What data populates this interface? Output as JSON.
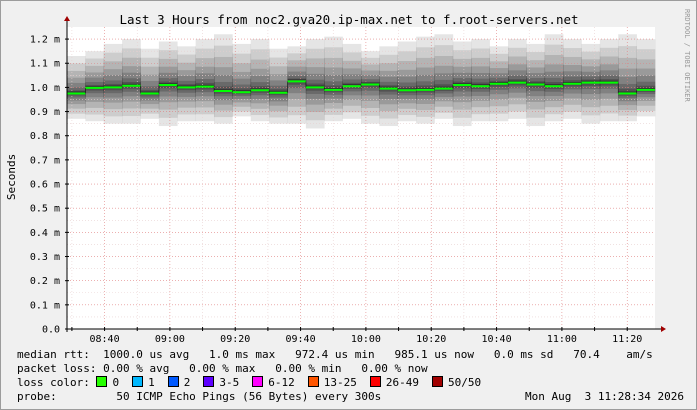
{
  "title": "Last 3 Hours from noc2.gva20.ip-max.net to f.root-servers.net",
  "watermark": "RRDTOOL / TOBI OETIKER",
  "chart_data": {
    "type": "line",
    "title": "Last 3 Hours from noc2.gva20.ip-max.net to f.root-servers.net",
    "ylabel": "Seconds",
    "ylim": [
      0,
      1.25
    ],
    "yticks": [
      {
        "v": 0,
        "label": "0.0"
      },
      {
        "v": 0.1,
        "label": "0.1 m"
      },
      {
        "v": 0.2,
        "label": "0.2 m"
      },
      {
        "v": 0.3,
        "label": "0.3 m"
      },
      {
        "v": 0.4,
        "label": "0.4 m"
      },
      {
        "v": 0.5,
        "label": "0.5 m"
      },
      {
        "v": 0.6,
        "label": "0.6 m"
      },
      {
        "v": 0.7,
        "label": "0.7 m"
      },
      {
        "v": 0.8,
        "label": "0.8 m"
      },
      {
        "v": 0.9,
        "label": "0.9 m"
      },
      {
        "v": 1.0,
        "label": "1.0 m"
      },
      {
        "v": 1.1,
        "label": "1.1 m"
      },
      {
        "v": 1.2,
        "label": "1.2 m"
      }
    ],
    "xticks": [
      "08:40",
      "09:00",
      "09:20",
      "09:40",
      "10:00",
      "10:20",
      "10:40",
      "11:00",
      "11:20"
    ],
    "series": [
      {
        "name": "median rtt",
        "color": "#00ff00",
        "values": [
          0.975,
          0.998,
          1.0,
          1.007,
          0.975,
          1.01,
          1.0,
          1.003,
          0.985,
          0.98,
          0.988,
          0.978,
          1.025,
          1.0,
          0.99,
          1.005,
          1.012,
          0.995,
          0.988,
          0.99,
          0.995,
          1.01,
          1.005,
          1.015,
          1.02,
          1.012,
          1.005,
          1.015,
          1.02,
          1.02,
          0.975,
          0.99
        ]
      }
    ],
    "spread_max": [
      1.13,
      1.15,
      1.18,
      1.2,
      1.16,
      1.19,
      1.17,
      1.2,
      1.22,
      1.18,
      1.2,
      1.16,
      1.17,
      1.2,
      1.21,
      1.18,
      1.15,
      1.17,
      1.19,
      1.21,
      1.22,
      1.19,
      1.2,
      1.17,
      1.2,
      1.18,
      1.22,
      1.2,
      1.18,
      1.2,
      1.22,
      1.2
    ],
    "spread_min": [
      0.87,
      0.86,
      0.85,
      0.85,
      0.87,
      0.84,
      0.86,
      0.86,
      0.85,
      0.88,
      0.86,
      0.85,
      0.85,
      0.83,
      0.86,
      0.87,
      0.85,
      0.84,
      0.86,
      0.85,
      0.87,
      0.84,
      0.86,
      0.86,
      0.87,
      0.84,
      0.86,
      0.87,
      0.85,
      0.86,
      0.86,
      0.88
    ]
  },
  "legend": {
    "median_line": "median rtt:  1000.0 us avg   1.0 ms max   972.4 us min   985.1 us now   0.0 ms sd   70.4    am/s",
    "loss_line": "packet loss: 0.00 % avg   0.00 % max   0.00 % min   0.00 % now",
    "loss_color_label": "loss color:",
    "loss_colors": [
      {
        "label": "0",
        "color": "#26ff00"
      },
      {
        "label": "1",
        "color": "#00b8ff"
      },
      {
        "label": "2",
        "color": "#0059ff"
      },
      {
        "label": "3-5",
        "color": "#5e00ff"
      },
      {
        "label": "6-12",
        "color": "#ff00ff"
      },
      {
        "label": "13-25",
        "color": "#ff5500"
      },
      {
        "label": "26-49",
        "color": "#ff0000"
      },
      {
        "label": "50/50",
        "color": "#a10000"
      }
    ],
    "probe_line": "probe:         50 ICMP Echo Pings (56 Bytes) every 300s",
    "timestamp": "Mon Aug  3 11:28:34 2026"
  }
}
